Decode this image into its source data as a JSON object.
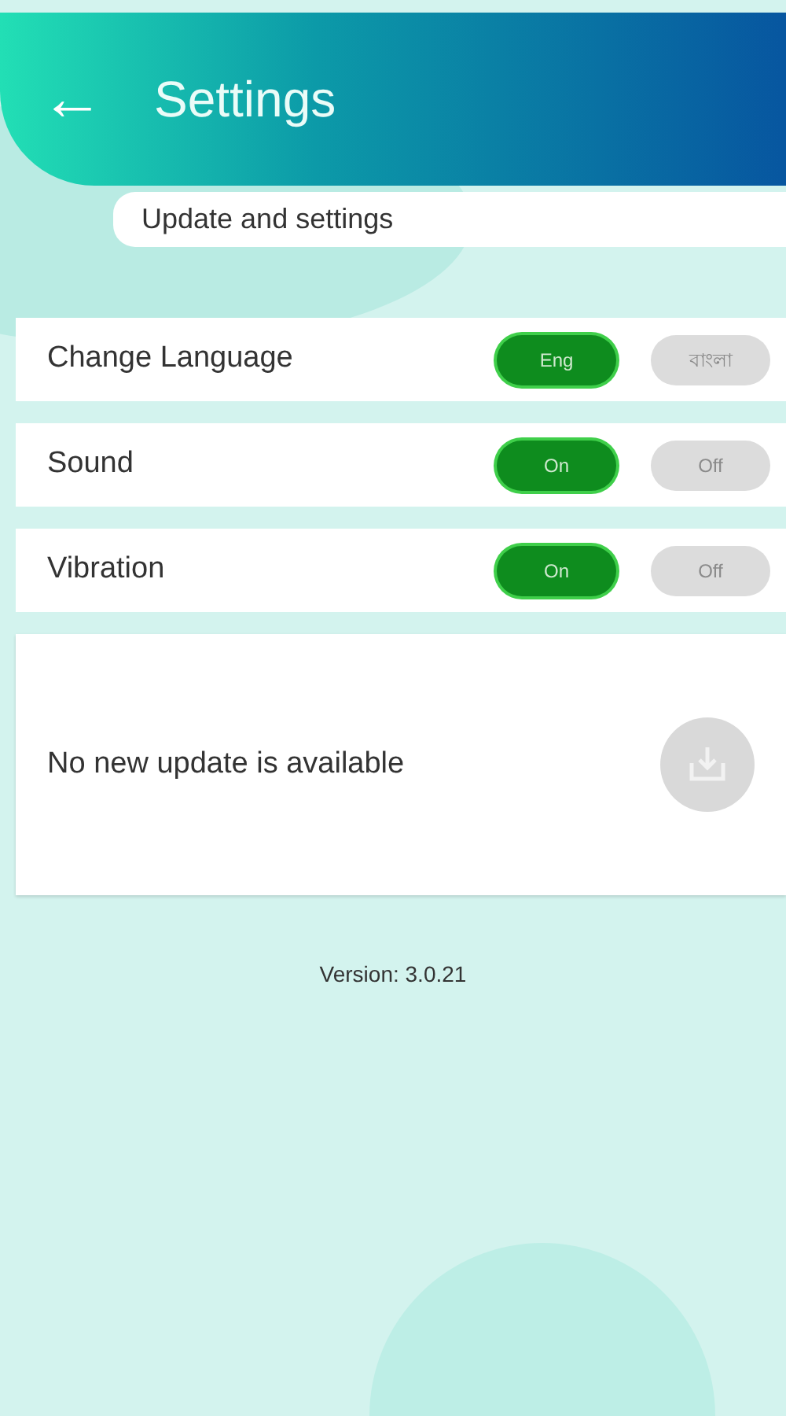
{
  "header": {
    "back": "←",
    "title": "Settings"
  },
  "subtitle": "Update and settings",
  "settings": [
    {
      "label": "Change Language",
      "options": [
        {
          "label": "Eng",
          "selected": true
        },
        {
          "label": "বাংলা",
          "selected": false
        }
      ]
    },
    {
      "label": "Sound",
      "options": [
        {
          "label": "On",
          "selected": true
        },
        {
          "label": "Off",
          "selected": false
        }
      ]
    },
    {
      "label": "Vibration",
      "options": [
        {
          "label": "On",
          "selected": true
        },
        {
          "label": "Off",
          "selected": false
        }
      ]
    }
  ],
  "update": {
    "message": "No new update is available",
    "download_disabled": true
  },
  "version": "Version: 3.0.21"
}
